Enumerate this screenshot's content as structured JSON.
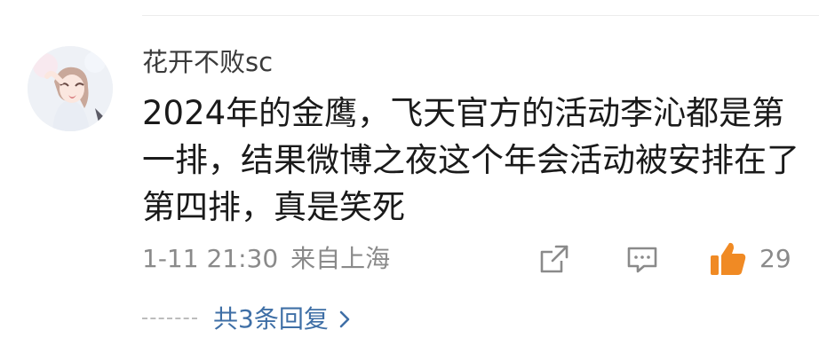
{
  "comment": {
    "username": "花开不败sc",
    "text": "2024年的金鹰，飞天官方的活动李沁都是第一排，结果微博之夜这个年会活动被安排在了第四排，真是笑死",
    "timestamp": "1-11 21:30",
    "location": "来自上海",
    "like_count": "29",
    "replies_label": "共3条回复"
  },
  "icons": {
    "share": "share-icon",
    "comment": "comment-icon",
    "like": "thumbs-up-icon",
    "chevron": "chevron-right-icon"
  },
  "colors": {
    "like_accent": "#f08a24",
    "link": "#3f6fa6",
    "meta": "#8a8a8a"
  }
}
